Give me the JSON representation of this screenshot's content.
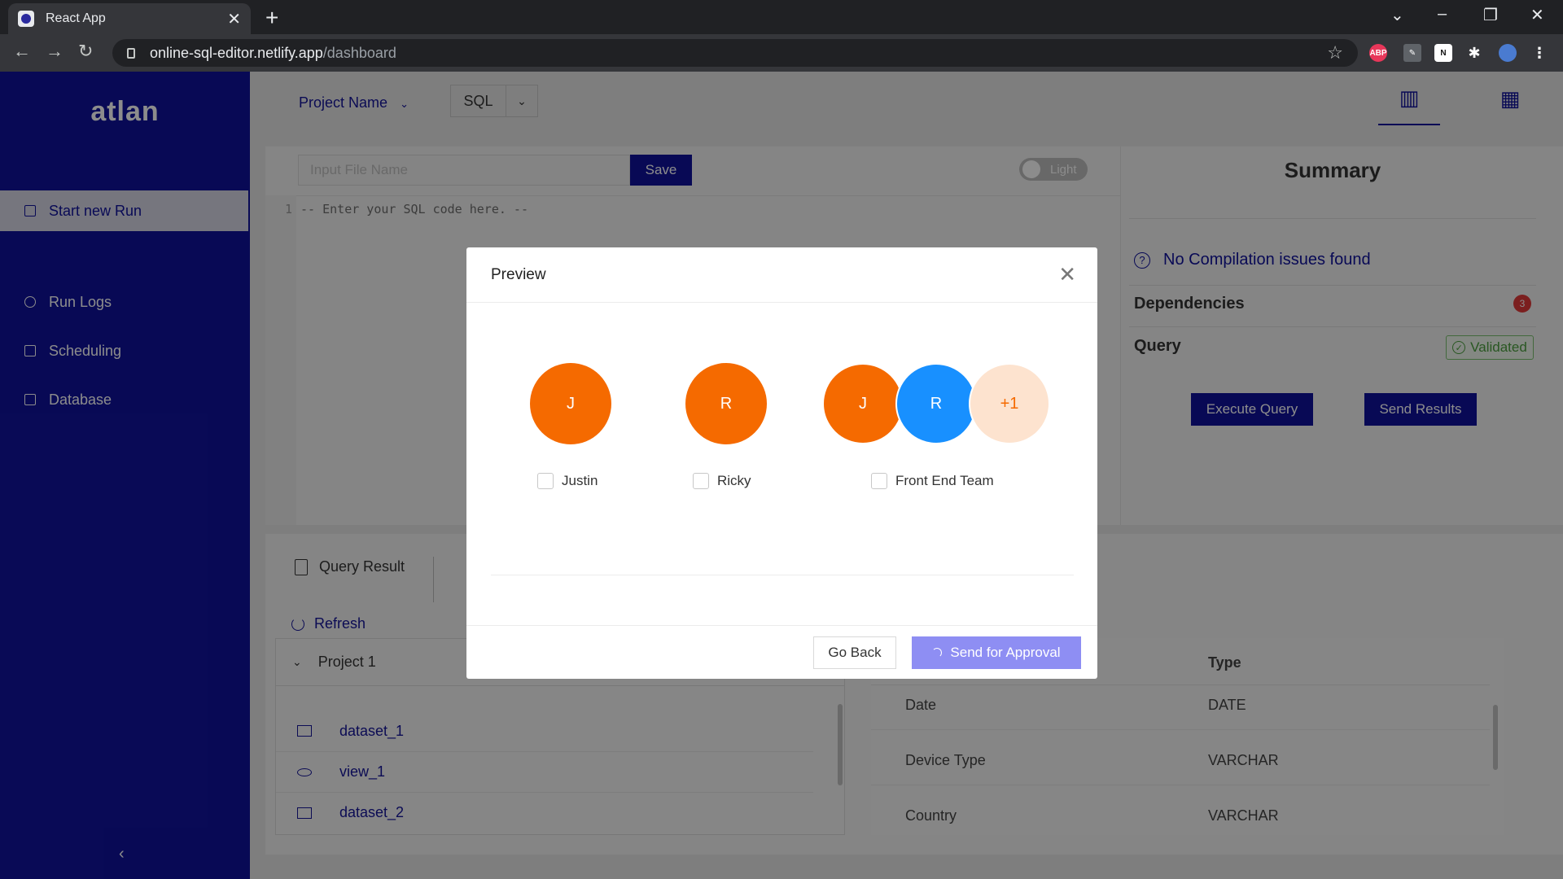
{
  "browser": {
    "tab_title": "React App",
    "url_domain": "online-sql-editor.netlify.app",
    "url_path": "/dashboard",
    "ext_abp": "ABP",
    "ext_n": "N"
  },
  "sidebar": {
    "logo": "atlan",
    "items": [
      {
        "label": "Start new Run",
        "active": true
      },
      {
        "label": "Run Logs",
        "active": false
      },
      {
        "label": "Scheduling",
        "active": false
      },
      {
        "label": "Database",
        "active": false
      }
    ],
    "collapse_icon": "chevron-left-icon"
  },
  "header": {
    "project_select": "Project Name",
    "language_select": "SQL"
  },
  "editor": {
    "file_name_placeholder": "Input File Name",
    "save_label": "Save",
    "theme_toggle_label": "Light",
    "line_number": "1",
    "code_placeholder": "-- Enter your SQL code here. --"
  },
  "summary": {
    "title": "Summary",
    "compilation": "No Compilation issues found",
    "dependencies_label": "Dependencies",
    "dependencies_count": "3",
    "query_label": "Query",
    "query_status": "Validated",
    "execute_label": "Execute Query",
    "send_results_label": "Send Results"
  },
  "results": {
    "tab_label": "Query Result",
    "refresh_label": "Refresh",
    "project": "Project 1",
    "tree_items": [
      "dataset_1",
      "view_1",
      "dataset_2"
    ],
    "table": {
      "type_header": "Type",
      "rows": [
        {
          "name": "Date",
          "type": "DATE"
        },
        {
          "name": "Device Type",
          "type": "VARCHAR"
        },
        {
          "name": "Country",
          "type": "VARCHAR"
        }
      ]
    }
  },
  "modal": {
    "title": "Preview",
    "recipients": [
      {
        "label": "Justin",
        "initial": "J"
      },
      {
        "label": "Ricky",
        "initial": "R"
      },
      {
        "label": "Front End Team",
        "initials": [
          "J",
          "R"
        ],
        "extra": "+1"
      }
    ],
    "go_back_label": "Go Back",
    "approve_label": "Send for Approval"
  },
  "colors": {
    "brand": "#10129c",
    "orange": "#f56a00",
    "blue": "#1890ff",
    "peach": "#fde3cf",
    "peach_text": "#f56a00"
  }
}
